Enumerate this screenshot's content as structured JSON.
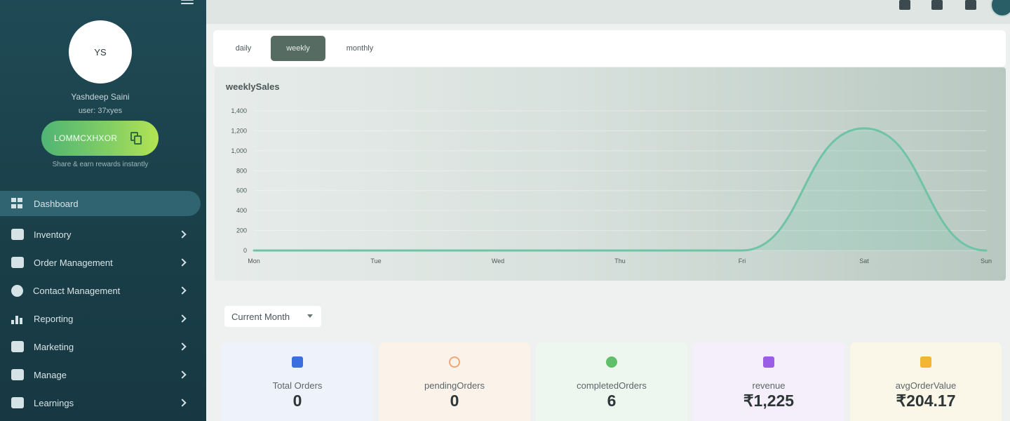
{
  "sidebar": {
    "avatar_initials": "YS",
    "user_name": "Yashdeep Saini",
    "user_id": "user: 37xyes",
    "referral_code": "LOMMCXHXOR",
    "share_hint": "Share & earn rewards instantly",
    "nav": [
      {
        "label": "Dashboard",
        "icon": "dashboard-icon"
      },
      {
        "label": "Inventory",
        "icon": "store-icon"
      },
      {
        "label": "Order Management",
        "icon": "cart-icon"
      },
      {
        "label": "Contact Management",
        "icon": "contact-icon"
      },
      {
        "label": "Reporting",
        "icon": "chart-icon"
      },
      {
        "label": "Marketing",
        "icon": "megaphone-icon"
      },
      {
        "label": "Manage",
        "icon": "manage-icon"
      },
      {
        "label": "Learnings",
        "icon": "graduation-cap-icon"
      }
    ]
  },
  "tabs": [
    {
      "label": "daily"
    },
    {
      "label": "weekly"
    },
    {
      "label": "monthly"
    }
  ],
  "active_tab": "weekly",
  "chart_data": {
    "type": "area",
    "title": "weeklySales",
    "categories": [
      "Mon",
      "Tue",
      "Wed",
      "Thu",
      "Fri",
      "Sat",
      "Sun"
    ],
    "series": [
      {
        "values": [
          0,
          0,
          0,
          0,
          0,
          1225,
          0
        ]
      }
    ],
    "y_ticks": [
      "0",
      "200",
      "400",
      "600",
      "800",
      "1,000",
      "1,200",
      "1,400"
    ],
    "ylim": [
      0,
      1400
    ],
    "grid": true,
    "color": "#6fc4a8"
  },
  "filter": {
    "selected": "Current Month"
  },
  "stats": [
    {
      "label": "Total Orders",
      "value": "0",
      "icon": "box-icon",
      "color": "#3b6fe0",
      "bg": "#eef3fb"
    },
    {
      "label": "pendingOrders",
      "value": "0",
      "icon": "clock-icon",
      "color": "#f0a878",
      "bg": "#fbf2ea"
    },
    {
      "label": "completedOrders",
      "value": "6",
      "icon": "check-circle-icon",
      "color": "#5fbf6a",
      "bg": "#eef7ef"
    },
    {
      "label": "revenue",
      "value": "₹1,225",
      "icon": "wallet-icon",
      "color": "#9b5de5",
      "bg": "#f4effa"
    },
    {
      "label": "avgOrderValue",
      "value": "₹204.17",
      "icon": "trend-icon",
      "color": "#f2b632",
      "bg": "#fbf7e8"
    }
  ]
}
